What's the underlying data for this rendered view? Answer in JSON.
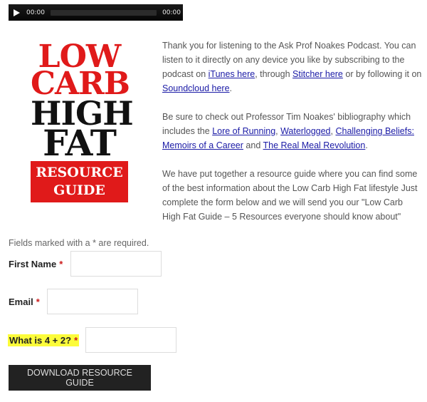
{
  "player": {
    "current_time": "00:00",
    "duration": "00:00",
    "play_icon": "play-icon"
  },
  "cover": {
    "lines": [
      "LOW",
      "CARB",
      "HIGH",
      "FAT"
    ],
    "box_lines": [
      "RESOURCE",
      "GUIDE"
    ],
    "colors": {
      "red": "#e01a1a",
      "black": "#111111"
    }
  },
  "intro": {
    "p1": {
      "t1": "Thank you for listening to the Ask Prof Noakes Podcast. You can listen to it directly on any device you like by subscribing to the podcast on ",
      "link1": "iTunes here",
      "t2": ", through ",
      "link2": "Stitcher here",
      "t3": " or by following it on ",
      "link3": "Soundcloud here",
      "t4": "."
    },
    "p2": {
      "t1": "Be sure to check out Professor Tim Noakes' bibliography which includes the ",
      "link1": "Lore of Running",
      "t2": ",  ",
      "link2": "Waterlogged",
      "t3": ", ",
      "link3": "Challenging Beliefs: Memoirs of a Career",
      "t4": " and ",
      "link4": "The Real Meal Revolution",
      "t5": "."
    },
    "p3": "We have put together a resource guide where you can find some of the best information about the Low Carb High Fat lifestyle Just complete the form below and we will send you our \"Low Carb High Fat Guide – 5 Resources everyone should know about\""
  },
  "form": {
    "required_note": "Fields marked with a * are required.",
    "fields": [
      {
        "label": "First Name",
        "star": "*",
        "value": ""
      },
      {
        "label": "Email",
        "star": "*",
        "value": ""
      },
      {
        "label": "What is 4 + 2?",
        "star": "*",
        "value": ""
      }
    ],
    "highlight_color": "#fcfc3a",
    "submit_label": "DOWNLOAD RESOURCE GUIDE"
  }
}
